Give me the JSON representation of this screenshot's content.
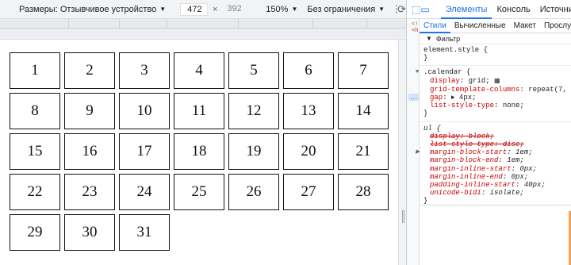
{
  "device_toolbar": {
    "dimensions_label": "Размеры: Отзывчивое устройство",
    "width_value": "472",
    "separator": "×",
    "height_placeholder": "392",
    "zoom": "150%",
    "throttle": "Без ограничения",
    "rotate_icon": "rotate-icon",
    "more_icon": "kebab-menu-icon"
  },
  "calendar": {
    "days": [
      "1",
      "2",
      "3",
      "4",
      "5",
      "6",
      "7",
      "8",
      "9",
      "10",
      "11",
      "12",
      "13",
      "14",
      "15",
      "16",
      "17",
      "18",
      "19",
      "20",
      "21",
      "22",
      "23",
      "24",
      "25",
      "26",
      "27",
      "28",
      "29",
      "30",
      "31"
    ]
  },
  "devtools": {
    "tabs": [
      "Элементы",
      "Консоль",
      "Источники"
    ],
    "active_tab": "Элементы",
    "subtabs": [
      "Стили",
      "Вычисленные",
      "Макет",
      "Прослуш"
    ],
    "active_subtab": "Стили",
    "filter_label": "Фильтр",
    "left_snippet_1": "<!",
    "left_snippet_2": "<h",
    "ellipsis": "…",
    "rules": {
      "element_style": "element.style {",
      "close": "}",
      "calendar_selector": ".calendar {",
      "calendar_props": [
        {
          "name": "display",
          "value": "grid;"
        },
        {
          "name": "grid-template-columns",
          "value": "repeat(7, 1fr);"
        },
        {
          "name": "gap",
          "value": "▸ 4px;"
        },
        {
          "name": "list-style-type",
          "value": "none;"
        }
      ],
      "ul_selector": "ul {",
      "ul_props": [
        {
          "name": "display",
          "value": "block;",
          "struck": true
        },
        {
          "name": "list-style-type",
          "value": "disc;",
          "struck": true
        },
        {
          "name": "margin-block-start",
          "value": "1em;"
        },
        {
          "name": "margin-block-end",
          "value": "1em;"
        },
        {
          "name": "margin-inline-start",
          "value": "0px;"
        },
        {
          "name": "margin-inline-end",
          "value": "0px;"
        },
        {
          "name": "padding-inline-start",
          "value": "40px;"
        },
        {
          "name": "unicode-bidi",
          "value": "isolate;"
        }
      ]
    }
  },
  "colors": {
    "accent": "#1a73e8",
    "css_property": "#c80000",
    "toolbar_bg": "#f1f3f4"
  }
}
